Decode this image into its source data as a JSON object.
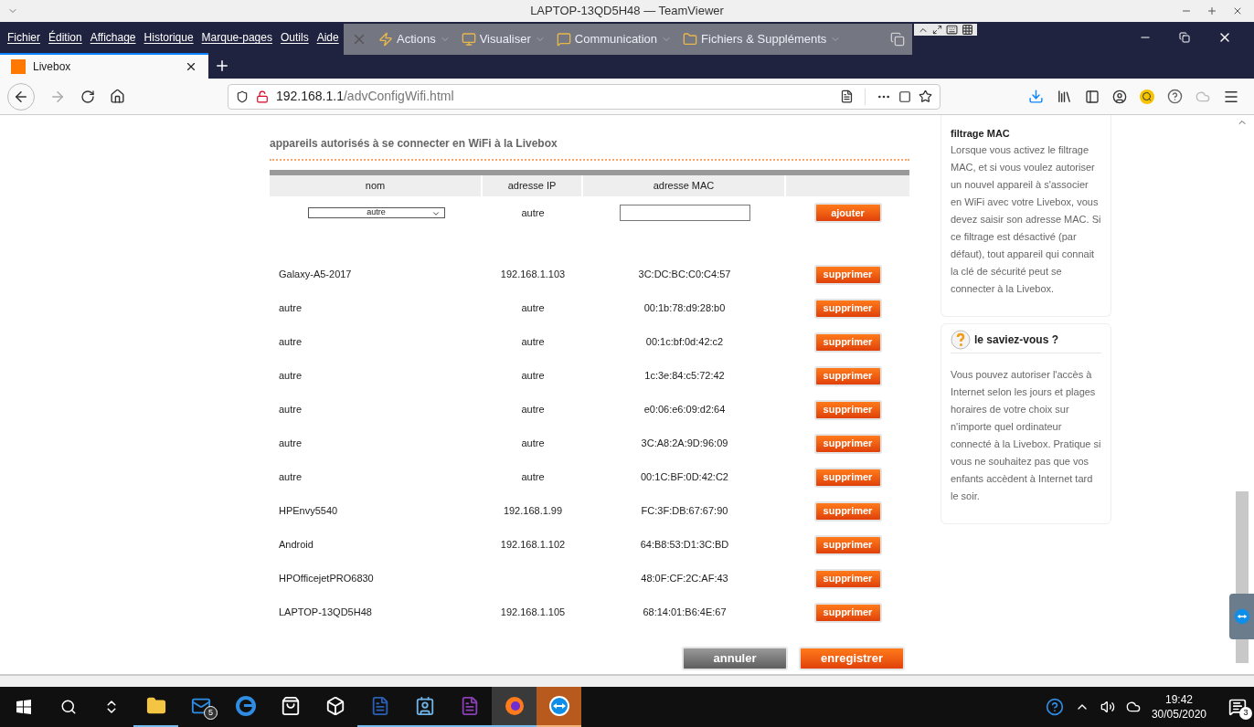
{
  "window": {
    "title": "LAPTOP-13QD5H48 — TeamViewer"
  },
  "menu_bar": [
    "Fichier",
    "Édition",
    "Affichage",
    "Historique",
    "Marque-pages",
    "Outils",
    "Aide"
  ],
  "remote_toolbar": [
    "Actions",
    "Visualiser",
    "Communication",
    "Fichiers & Suppléments"
  ],
  "tabs": [
    {
      "label": "Livebox",
      "selected": true
    }
  ],
  "address_bar": {
    "host": "192.168.1.1",
    "path": "/advConfigWifi.html"
  },
  "section_title": "appareils autorisés à se connecter en WiFi à la Livebox",
  "table": {
    "columns": [
      "nom",
      "adresse IP",
      "adresse MAC"
    ],
    "add_row": {
      "name": "autre",
      "ip": "autre",
      "button": "ajouter"
    },
    "rows": [
      {
        "name": "Galaxy-A5-2017",
        "ip": "192.168.1.103",
        "mac": "3C:DC:BC:C0:C4:57",
        "button": "supprimer"
      },
      {
        "name": "autre",
        "ip": "autre",
        "mac": "00:1b:78:d9:28:b0",
        "button": "supprimer"
      },
      {
        "name": "autre",
        "ip": "autre",
        "mac": "00:1c:bf:0d:42:c2",
        "button": "supprimer"
      },
      {
        "name": "autre",
        "ip": "autre",
        "mac": "1c:3e:84:c5:72:42",
        "button": "supprimer"
      },
      {
        "name": "autre",
        "ip": "autre",
        "mac": "e0:06:e6:09:d2:64",
        "button": "supprimer"
      },
      {
        "name": "autre",
        "ip": "autre",
        "mac": "3C:A8:2A:9D:96:09",
        "button": "supprimer"
      },
      {
        "name": "autre",
        "ip": "autre",
        "mac": "00:1C:BF:0D:42:C2",
        "button": "supprimer"
      },
      {
        "name": "HPEnvy5540",
        "ip": "192.168.1.99",
        "mac": "FC:3F:DB:67:67:90",
        "button": "supprimer"
      },
      {
        "name": "Android",
        "ip": "192.168.1.102",
        "mac": "64:B8:53:D1:3C:BD",
        "button": "supprimer"
      },
      {
        "name": "HPOfficejetPRO6830",
        "mac": "48:0F:CF:2C:AF:43",
        "button": "supprimer"
      },
      {
        "name": "LAPTOP-13QD5H48",
        "ip": "192.168.1.105",
        "mac": "68:14:01:B6:4E:67",
        "button": "supprimer"
      }
    ]
  },
  "actions": [
    {
      "label": "annuler",
      "kind": "secondary"
    },
    {
      "label": "enregistrer",
      "kind": "primary"
    }
  ],
  "sidebar": [
    {
      "kind": "info",
      "title": "filtrage MAC",
      "text": "Lorsque vous activez le filtrage MAC, et si vous voulez autoriser un nouvel appareil à s'associer en WiFi avec votre Livebox, vous devez saisir son adresse MAC. Si ce filtrage est désactivé (par défaut), tout appareil qui connait la clé de sécurité peut se connecter à la Livebox."
    },
    {
      "kind": "tip",
      "title": "le saviez-vous ?",
      "text": "Vous pouvez autoriser l'accès à Internet selon les jours et plages horaires de votre choix sur n'importe quel ordinateur connecté à la Livebox. Pratique si vous ne souhaitez pas que vos enfants accèdent à Internet tard le soir."
    }
  ],
  "taskbar": {
    "apps": [
      {
        "kind": "explorer",
        "running": true,
        "selected": false
      },
      {
        "kind": "mail",
        "running": false,
        "selected": false,
        "badge": "5"
      },
      {
        "kind": "edge",
        "running": false,
        "selected": false
      },
      {
        "kind": "store",
        "running": false,
        "selected": false
      },
      {
        "kind": "dropbox",
        "running": false,
        "selected": false
      },
      {
        "kind": "word",
        "running": true,
        "selected": false
      },
      {
        "kind": "contacts",
        "running": true,
        "selected": false
      },
      {
        "kind": "onenote",
        "running": true,
        "selected": false
      },
      {
        "kind": "firefox",
        "running": true,
        "selected": false
      },
      {
        "kind": "teamviewer",
        "running": true,
        "selected": true
      }
    ],
    "time": "19:42",
    "date": "30/05/2020",
    "notifications": "3"
  }
}
